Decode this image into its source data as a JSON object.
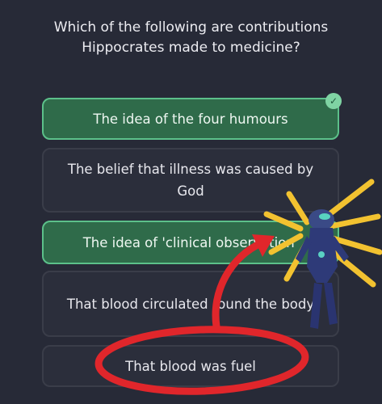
{
  "question": "Which of the following are contributions Hippocrates made to medicine?",
  "options": [
    {
      "label": "The idea of the four humours",
      "selected": true
    },
    {
      "label": "The belief that illness was caused by God",
      "selected": false
    },
    {
      "label": "The idea of 'clinical observation'",
      "selected": true
    },
    {
      "label": "That blood circulated round the body",
      "selected": false
    },
    {
      "label": "That blood was fuel",
      "selected": false
    }
  ],
  "check_icon": "checkmark-icon",
  "colors": {
    "background": "#272a37",
    "option_bg": "#2b2e3b",
    "selected_bg": "#2f6b4a",
    "selected_border": "#5cc08a",
    "annotation_red": "#e0262b"
  }
}
